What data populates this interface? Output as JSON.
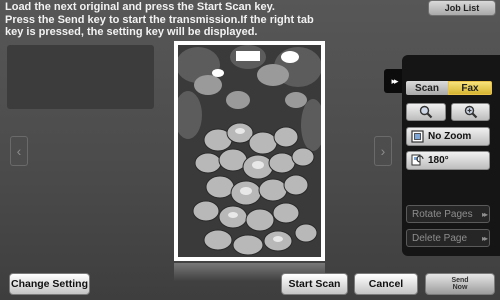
{
  "message": {
    "line1": "Load the next original and press the Start Scan key.",
    "line2": "Press the Send key to start the transmission.If the right tab",
    "line3": "key is pressed, the setting key will be displayed."
  },
  "header": {
    "job_list": "Job List"
  },
  "panel": {
    "expand_glyph": "▸▸",
    "tabs": [
      {
        "label": "Scan",
        "selected": false
      },
      {
        "label": "Fax",
        "selected": true
      }
    ],
    "zoom_out_icon": "zoom-out-icon",
    "zoom_in_icon": "zoom-in-icon",
    "no_zoom": "No Zoom",
    "rotate_180": "180°",
    "rotate_pages": "Rotate Pages",
    "delete_page": "Delete Page",
    "disabled_arrow": "▸▸"
  },
  "nav": {
    "prev_glyph": "‹",
    "next_glyph": "›"
  },
  "footer": {
    "change_setting": "Change Setting",
    "start_scan": "Start Scan",
    "cancel": "Cancel",
    "send_now_line1": "Send",
    "send_now_line2": "Now"
  },
  "colors": {
    "fax_tab": "#e6c84a",
    "panel_bg": "#151515",
    "screen_bg": "#4e4e4e"
  }
}
